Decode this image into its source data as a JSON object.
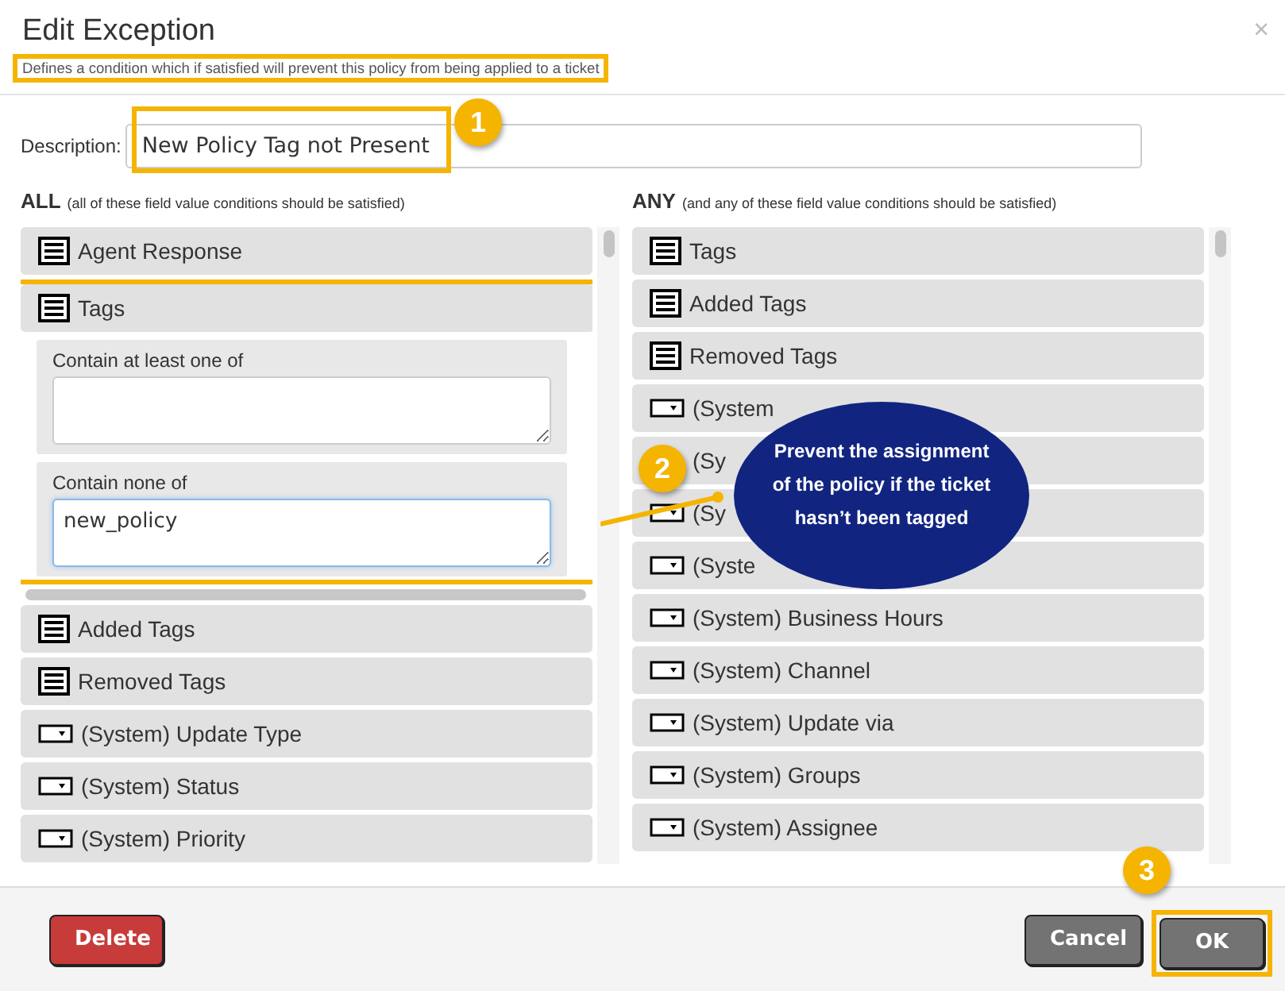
{
  "window": {
    "title": "Edit Exception",
    "subtitle": "Defines a condition which if satisfied will prevent this policy from being applied to a ticket",
    "close": "×"
  },
  "description": {
    "label": "Description:",
    "value": "New Policy Tag not Present"
  },
  "all_column": {
    "heading": "ALL",
    "hint": "(all of these field value conditions should be satisfied)",
    "items": [
      {
        "label": "Agent Response",
        "kind": "list",
        "expanded": false
      },
      {
        "label": "Tags",
        "kind": "list",
        "expanded": true,
        "fields": [
          {
            "label": "Contain at least one of",
            "focused": false
          },
          {
            "label": "Contain none of",
            "value": "new_policy",
            "focused": true
          }
        ]
      },
      {
        "label": "Added Tags",
        "kind": "list",
        "expanded": false
      },
      {
        "label": "Removed Tags",
        "kind": "list",
        "expanded": false
      },
      {
        "label": "(System) Update Type",
        "kind": "dropdown",
        "expanded": false
      },
      {
        "label": "(System) Status",
        "kind": "dropdown",
        "expanded": false
      },
      {
        "label": "(System) Priority",
        "kind": "dropdown",
        "expanded": false
      }
    ]
  },
  "any_column": {
    "heading": "ANY",
    "hint": "(and any of these field value conditions should be satisfied)",
    "items": [
      {
        "label": "Tags",
        "kind": "list",
        "expanded": false
      },
      {
        "label": "Added Tags",
        "kind": "list",
        "expanded": false
      },
      {
        "label": "Removed Tags",
        "kind": "list",
        "expanded": false
      },
      {
        "label": "(System",
        "kind": "dropdown",
        "expanded": false
      },
      {
        "label": "(Sy",
        "kind": "covered",
        "expanded": false
      },
      {
        "label": "(Sy",
        "kind": "dropdown",
        "expanded": false
      },
      {
        "label": "(Syste",
        "kind": "dropdown",
        "expanded": false
      },
      {
        "label": "(System) Business Hours",
        "kind": "dropdown",
        "expanded": false
      },
      {
        "label": "(System) Channel",
        "kind": "dropdown",
        "expanded": false
      },
      {
        "label": "(System) Update via",
        "kind": "dropdown",
        "expanded": false
      },
      {
        "label": "(System) Groups",
        "kind": "dropdown",
        "expanded": false
      },
      {
        "label": "(System) Assignee",
        "kind": "dropdown",
        "expanded": false
      }
    ]
  },
  "footer": {
    "buttons": [
      {
        "label": "Delete",
        "kind": "danger"
      },
      {
        "label": "Cancel",
        "kind": "secondary"
      },
      {
        "label": "OK",
        "kind": "primary"
      }
    ]
  },
  "annotations": {
    "badges": [
      "1",
      "2",
      "3"
    ],
    "callout": "Prevent the assignment of the policy if the ticket hasn’t been tagged"
  }
}
